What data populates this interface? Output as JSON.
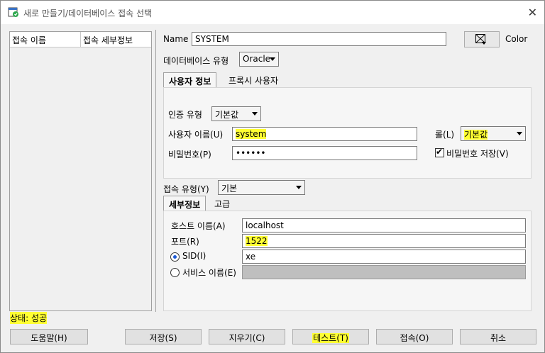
{
  "window": {
    "title": "새로 만들기/데이터베이스 접속 선택"
  },
  "left_panel": {
    "col1": "접속 이름",
    "col2": "접속 세부정보"
  },
  "name": {
    "label": "Name",
    "value": "SYSTEM"
  },
  "color": {
    "label": "Color"
  },
  "db_type": {
    "label": "데이터베이스 유형",
    "value": "Oracle"
  },
  "tabs_user": [
    {
      "label": "사용자 정보"
    },
    {
      "label": "프록시 사용자"
    }
  ],
  "auth": {
    "label": "인증 유형",
    "value": "기본값"
  },
  "username": {
    "label": "사용자 이름(U)",
    "value": "system"
  },
  "role": {
    "label": "롤(L)",
    "value": "기본값"
  },
  "password": {
    "label": "비밀번호(P)",
    "value": "••••••"
  },
  "save_password": {
    "label": "비밀번호 저장(V)",
    "checked": true
  },
  "conn_type": {
    "label": "접속 유형(Y)",
    "value": "기본"
  },
  "tabs_detail": [
    {
      "label": "세부정보"
    },
    {
      "label": "고급"
    }
  ],
  "host": {
    "label": "호스트 이름(A)",
    "value": "localhost"
  },
  "port": {
    "label": "포트(R)",
    "value": "1522"
  },
  "sid": {
    "label": "SID(I)",
    "value": "xe",
    "selected": true
  },
  "service": {
    "label": "서비스 이름(E)",
    "value": ""
  },
  "status": {
    "text": "상태: 성공"
  },
  "buttons": {
    "help": "도움말(H)",
    "save": "저장(S)",
    "clear": "지우기(C)",
    "test": "테스트(T)",
    "connect": "접속(O)",
    "cancel": "취소"
  }
}
